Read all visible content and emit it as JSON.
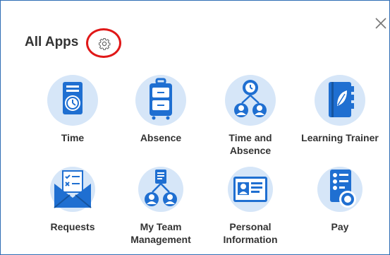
{
  "header": {
    "title": "All Apps"
  },
  "colors": {
    "border": "#2f6db5",
    "highlight": "#e01818",
    "icon_bg": "#d6e6f8",
    "icon_main": "#1f6fd1"
  },
  "apps": [
    {
      "label": "Time",
      "icon": "time-clock-icon"
    },
    {
      "label": "Absence",
      "icon": "suitcase-icon"
    },
    {
      "label": "Time and\nAbsence",
      "icon": "people-clock-icon"
    },
    {
      "label": "Learning Trainer",
      "icon": "notebook-leaf-icon"
    },
    {
      "label": "Requests",
      "icon": "envelope-checklist-icon"
    },
    {
      "label": "My Team\nManagement",
      "icon": "team-org-icon"
    },
    {
      "label": "Personal\nInformation",
      "icon": "id-card-icon"
    },
    {
      "label": "Pay",
      "icon": "paystub-coin-icon"
    }
  ]
}
